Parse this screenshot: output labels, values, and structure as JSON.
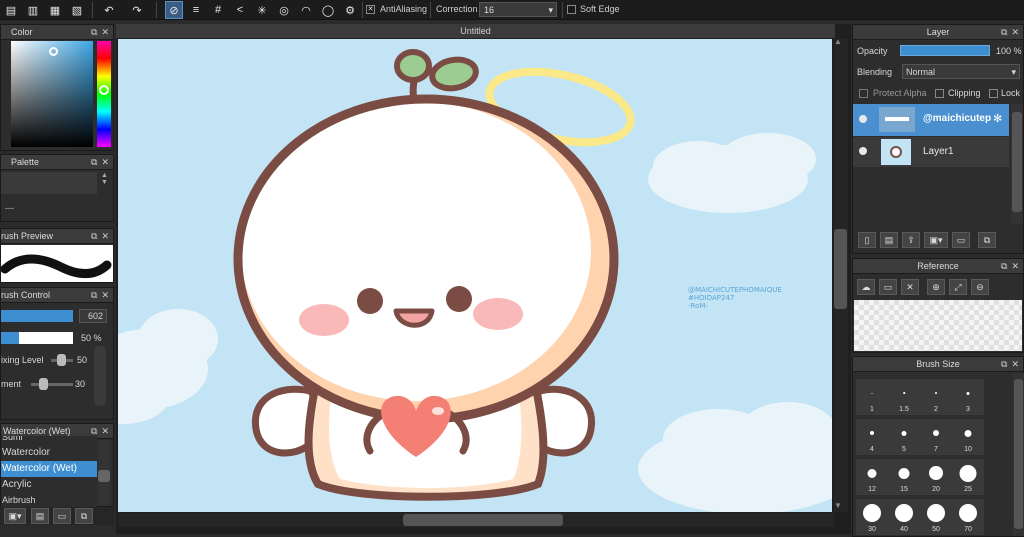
{
  "toolbar": {
    "antialiasing_label": "AntiAliasing",
    "correction_label": "Correction",
    "correction_value": "16",
    "soft_edge_label": "Soft Edge"
  },
  "canvas": {
    "tab_title": "Untitled",
    "watermark": [
      "@MAICHICUTEPHOMAIQUE",
      "#HOIDAP247",
      "-RoM-"
    ]
  },
  "color_panel": {
    "title": "Color"
  },
  "palette_panel": {
    "title": "Palette",
    "value": "---"
  },
  "brush_preview_panel": {
    "title": "rush Preview"
  },
  "brush_control_panel": {
    "title": "rush Control",
    "size_value": "602",
    "opacity_value": "50 %",
    "mixing_label": "ixing Level",
    "mixing_value": "50",
    "dilution_label": "ment",
    "dilution_value": "30"
  },
  "brush_list": {
    "title": "Watercolor (Wet)",
    "items": [
      "Sumi",
      "Watercolor",
      "Watercolor (Wet)",
      "Acrylic",
      "Airbrush"
    ],
    "selected": 2
  },
  "layer_panel": {
    "title": "Layer",
    "opacity_label": "Opacity",
    "opacity_value": "100 %",
    "opacity_fraction": 1.0,
    "blending_label": "Blending",
    "blending_value": "Normal",
    "protect_alpha_label": "Protect Alpha",
    "clipping_label": "Clipping",
    "lock_label": "Lock",
    "layers": [
      {
        "name": "@maichicutep",
        "selected": true
      },
      {
        "name": "Layer1",
        "selected": false
      }
    ]
  },
  "reference_panel": {
    "title": "Reference"
  },
  "brush_size_panel": {
    "title": "Brush Size",
    "sizes": [
      "1",
      "1.5",
      "2",
      "3",
      "4",
      "5",
      "7",
      "10",
      "12",
      "15",
      "20",
      "25",
      "30",
      "40",
      "50",
      "70"
    ]
  },
  "colors": {
    "sky": "#c3e4f4",
    "outline": "#7a4c44",
    "accent_blue": "#3d8fd1",
    "selected_layer": "#4a90d0"
  }
}
